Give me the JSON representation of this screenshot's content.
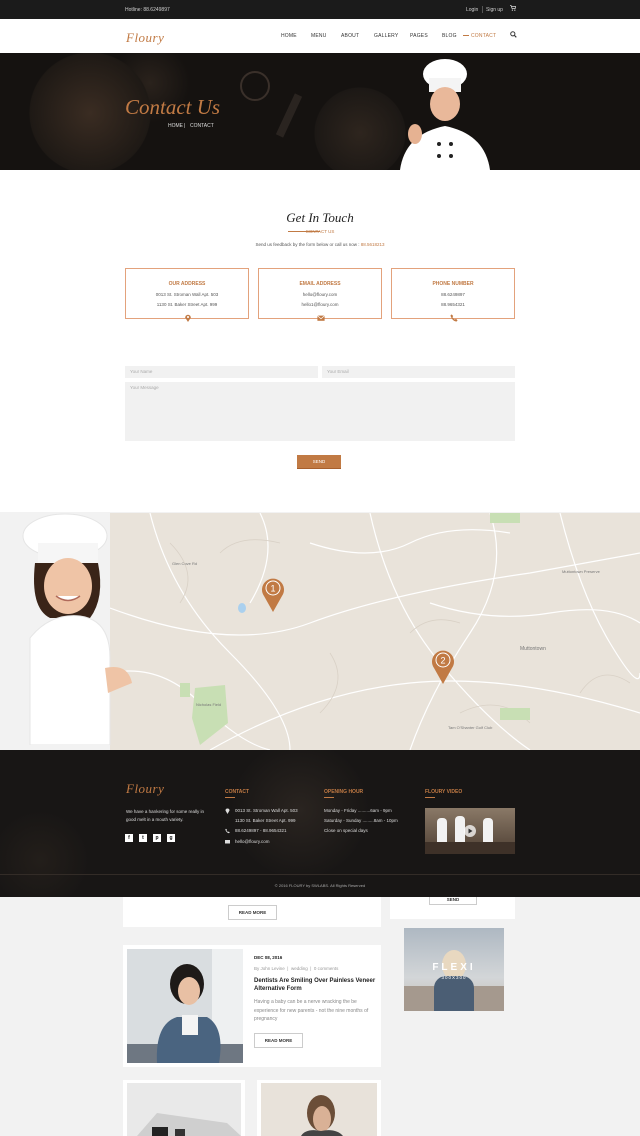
{
  "topbar": {
    "hotline": "Hotline: 88.6249897",
    "login": "Login",
    "signup": "Sign up",
    "cart_icon": "cart-icon"
  },
  "nav": {
    "logo": "Floury",
    "items": [
      {
        "label": "HOME"
      },
      {
        "label": "MENU"
      },
      {
        "label": "ABOUT"
      },
      {
        "label": "GALLERY"
      },
      {
        "label": "PAGES"
      },
      {
        "label": "BLOG"
      },
      {
        "label": "CONTACT"
      }
    ],
    "search_icon": "search-icon",
    "accent": "#c17a44"
  },
  "hero": {
    "title": "Contact Us",
    "crumb_home": "HOME",
    "crumb_sep": "|",
    "crumb_current": "CONTACT"
  },
  "touch": {
    "title": "Get In Touch",
    "subtitle": "CONTACT US",
    "text": "Send us feedback by the form below or call us now : ",
    "phone": "88.5618213"
  },
  "cards": [
    {
      "heading": "OUR ADDRESS",
      "line1": "0013 St. Stroman Wall Apt. 503",
      "line2": "1130 St. Baker Street Apt. 999",
      "icon": "map-pin-icon"
    },
    {
      "heading": "EMAIL ADDRESS",
      "line1": "hello@floury.com",
      "line2": "hello1@floury.com",
      "icon": "envelope-icon"
    },
    {
      "heading": "PHONE NUMBER",
      "line1": "88.6249897",
      "line2": "88.9654321",
      "icon": "phone-icon"
    }
  ],
  "form": {
    "name_placeholder": "Your Name",
    "email_placeholder": "Your Email",
    "message_placeholder": "Your Message",
    "send": "SEND"
  },
  "map": {
    "marker1": "1",
    "marker2": "2",
    "labels": [
      "Mullentown",
      "Muttontown",
      "Muttontown Preserve",
      "Yeomans Woods Nature Preserve",
      "Nicholas Field",
      "Tam O'Shanter Golf Club",
      "Glen Cove Rd"
    ]
  },
  "footer": {
    "logo": "Floury",
    "about": "We have a hankering for some really in good melt in a mouth variety.",
    "contact_heading": "CONTACT",
    "address1": "0013 St. Stroman Wall Apt. 503",
    "address2": "1130 St. Baker Street Apt. 999",
    "phones": "88.6249897 - 88.9654321",
    "email": "hello@floury.com",
    "hours_heading": "OPENING HOUR",
    "hours1": "Monday - Friday ..........6am - 9pm",
    "hours2": "Saturday - Sunday .........8am - 10pm",
    "hours3": "Close on special days",
    "video_heading": "FLOURY VIDEO",
    "social": [
      "f",
      "t",
      "p",
      "g"
    ],
    "copyright": "© 2016 FLOURY by SWLABS. All Rights Reserved"
  },
  "blog": {
    "read_more": "READ MORE",
    "date": "DEC 08, 2016",
    "author": "By John Levine",
    "category": "wedding",
    "comments": "0 comments",
    "title": "Dentists Are Smiling Over Painless Veneer Alternative Form",
    "excerpt": "Having a baby can be a nerve wracking the be experience for new parents - not the nine months of pregnancy",
    "send_partial": "SEND",
    "flexi_title": "FLEXI",
    "flexi_size": "300X300"
  }
}
